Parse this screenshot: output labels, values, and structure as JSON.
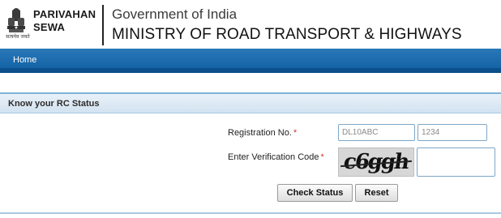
{
  "brand": {
    "line1": "PARIVAHAN",
    "line2": "SEWA",
    "emblem_tagline": "सत्यमेव जयते"
  },
  "header": {
    "government": "Government of India",
    "ministry": "MINISTRY OF ROAD TRANSPORT & HIGHWAYS"
  },
  "nav": {
    "home": "Home"
  },
  "panel": {
    "title": "Know your RC Status"
  },
  "form": {
    "registration_label": "Registration No.",
    "verification_label": "Enter Verification Code",
    "required_mark": "*",
    "reg_part1_placeholder": "DL10ABC",
    "reg_part2_placeholder": "1234",
    "captcha_text": "c6ggh",
    "captcha_value": ""
  },
  "buttons": {
    "check_status": "Check Status",
    "reset": "Reset"
  },
  "colors": {
    "nav_bar": "#0f5ea1",
    "panel_header": "#d3e3f1",
    "required": "#d9342b"
  }
}
